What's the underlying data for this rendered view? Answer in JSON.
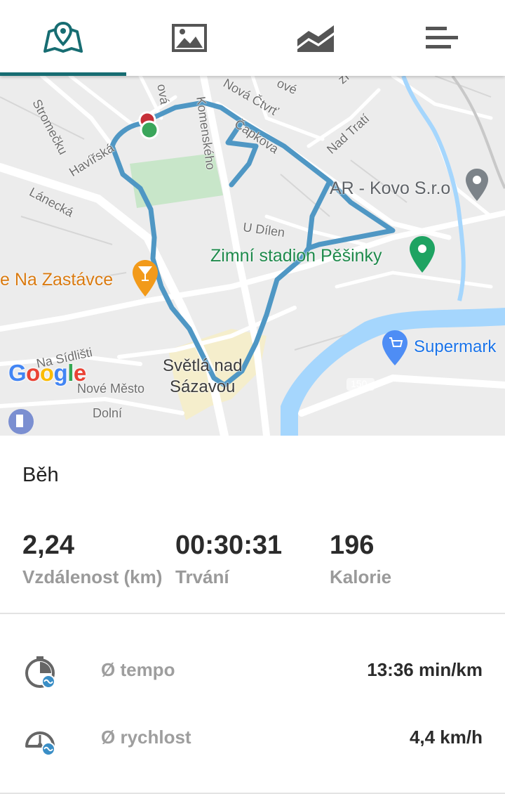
{
  "tabs": [
    {
      "name": "map-tab",
      "icon": "map-pin-book-icon",
      "active": true
    },
    {
      "name": "photos-tab",
      "icon": "image-icon",
      "active": false
    },
    {
      "name": "charts-tab",
      "icon": "area-chart-icon",
      "active": false
    },
    {
      "name": "details-tab",
      "icon": "bars-list-icon",
      "active": false
    }
  ],
  "map": {
    "streets": [
      "Stromečku",
      "Havířská",
      "Lánecká",
      "Komenského",
      "Čapkova",
      "Nová Čtvrť",
      "Nad Tratí",
      "U Dílen",
      "Na Sídlišti",
      "Nové Město",
      "Dolní"
    ],
    "street_fragments": [
      "ová",
      "ové",
      "zí"
    ],
    "pois": {
      "ar_kovo": "AR - Kovo S.r.o",
      "zimni_stadion": "Zimní stadion Pěšinky",
      "na_zastavce": "e Na Zastávce",
      "supermarket": "Supermark"
    },
    "town": "Světlá nad\nSázavou",
    "road_number": "150",
    "logo": "Google",
    "route_color": "#4f97c4",
    "water_color": "#a5d6fd",
    "park_color": "#c8e6c9"
  },
  "activity": {
    "type": "Běh",
    "distance_value": "2,24",
    "distance_label": "Vzdálenost (km)",
    "duration_value": "00:30:31",
    "duration_label": "Trvání",
    "calories_value": "196",
    "calories_label": "Kalorie"
  },
  "metrics": [
    {
      "label": "Ø tempo",
      "value": "13:36 min/km",
      "icon": "pace-stopwatch-icon"
    },
    {
      "label": "Ø rychlost",
      "value": "4,4 km/h",
      "icon": "speedometer-icon"
    }
  ],
  "colors": {
    "accent": "#176d72",
    "label_gray": "#9a9a9a"
  }
}
